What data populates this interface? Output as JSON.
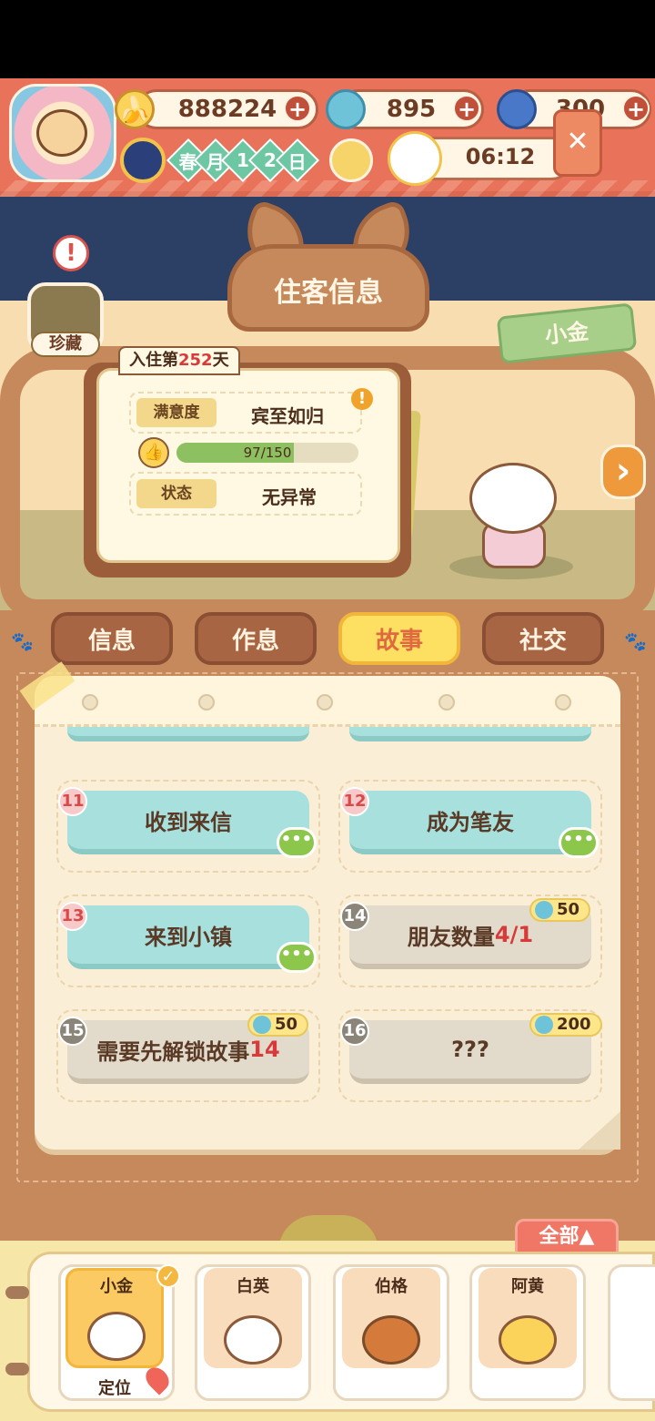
{
  "resources": {
    "bananas": "888224",
    "flames": "895",
    "fish": "300"
  },
  "date": {
    "chars": [
      "春",
      "月",
      "1",
      "2",
      "日"
    ]
  },
  "clock": "06:12",
  "panel_title": "住客信息",
  "collection_label": "珍藏",
  "guest_name": "小金",
  "stay": {
    "prefix": "入住第",
    "days": "252",
    "suffix": "天"
  },
  "satisfaction": {
    "label": "满意度",
    "value": "宾至如归",
    "progress_text": "97/150",
    "progress_fraction": 0.6467
  },
  "status": {
    "label": "状态",
    "value": "无异常"
  },
  "tabs": [
    "信息",
    "作息",
    "故事",
    "社交"
  ],
  "active_tab": "故事",
  "stories": [
    {
      "num": "11",
      "text": "收到来信",
      "state": "open"
    },
    {
      "num": "12",
      "text": "成为笔友",
      "state": "open"
    },
    {
      "num": "13",
      "text": "来到小镇",
      "state": "open"
    },
    {
      "num": "14",
      "text": "朋友数量 ",
      "highlight": "4/1",
      "state": "locked",
      "cost": "50"
    },
    {
      "num": "15",
      "text": "需要先解锁故事",
      "highlight": "14",
      "state": "locked",
      "cost": "50"
    },
    {
      "num": "16",
      "text": "???",
      "state": "locked",
      "cost": "200"
    }
  ],
  "bubble_glyph": "•••",
  "roster": {
    "all_button": "全部▲",
    "locate_label": "定位",
    "guests": [
      "小金",
      "白英",
      "伯格",
      "阿黄"
    ]
  },
  "colors": {
    "accent_red": "#e8735a",
    "wood": "#c6895b",
    "story_open": "#a7e0dc",
    "story_locked": "#e2dbcc",
    "highlight_red": "#d83a3a"
  },
  "icons": [
    "banana-icon",
    "flame-icon",
    "fish-icon",
    "plus-icon",
    "sun-moon-icon",
    "moon-icon",
    "cat-clock-icon",
    "tag-icon",
    "thumb-up-icon",
    "warning-icon",
    "chat-bubble-icon",
    "check-icon",
    "location-pin-icon",
    "paw-icon",
    "arrow-right-icon"
  ]
}
